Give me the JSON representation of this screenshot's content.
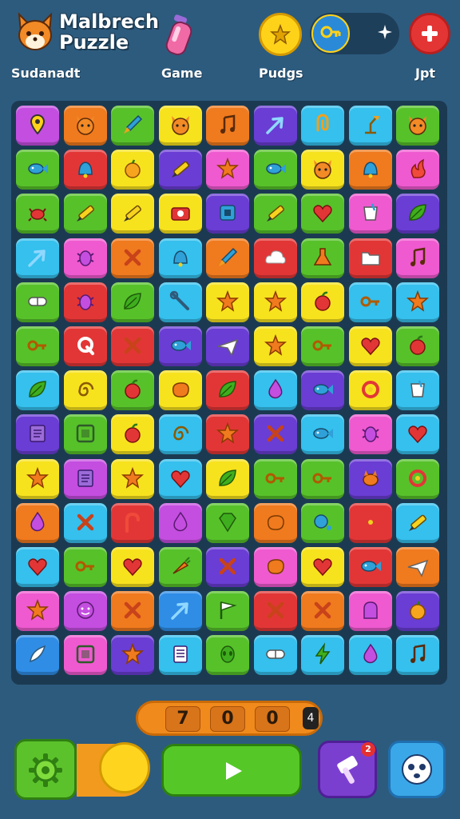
{
  "header": {
    "title_line1": "Malbrech",
    "title_line2": "Puzzle",
    "labels": [
      "Sudanadt",
      "Game",
      "Pudgs",
      "Jpt"
    ]
  },
  "board": {
    "rows": 13,
    "cols": 9,
    "palette": {
      "p": "#c44ee0",
      "o": "#f07a1e",
      "g": "#57c12a",
      "y": "#f7e21e",
      "c": "#35c0ee",
      "v": "#6a3dd4",
      "r": "#e23636",
      "m": "#ef5ad0",
      "b": "#2f8de6"
    },
    "tiles": [
      [
        "p",
        "o",
        "g",
        "y",
        "o",
        "v",
        "c",
        "c",
        "g"
      ],
      [
        "g",
        "r",
        "y",
        "v",
        "m",
        "g",
        "y",
        "o",
        "m"
      ],
      [
        "g",
        "g",
        "y",
        "y",
        "v",
        "g",
        "g",
        "m",
        "v"
      ],
      [
        "c",
        "m",
        "o",
        "c",
        "o",
        "r",
        "g",
        "r",
        "m"
      ],
      [
        "g",
        "r",
        "g",
        "c",
        "y",
        "y",
        "y",
        "c",
        "c"
      ],
      [
        "g",
        "r",
        "r",
        "v",
        "v",
        "y",
        "g",
        "y",
        "g"
      ],
      [
        "c",
        "y",
        "g",
        "y",
        "r",
        "c",
        "v",
        "y",
        "c"
      ],
      [
        "v",
        "g",
        "y",
        "c",
        "r",
        "v",
        "c",
        "m",
        "c"
      ],
      [
        "y",
        "p",
        "y",
        "c",
        "y",
        "g",
        "g",
        "v",
        "g"
      ],
      [
        "o",
        "c",
        "r",
        "p",
        "g",
        "o",
        "g",
        "r",
        "c"
      ],
      [
        "c",
        "g",
        "y",
        "g",
        "v",
        "m",
        "y",
        "r",
        "o"
      ],
      [
        "m",
        "p",
        "o",
        "b",
        "g",
        "r",
        "o",
        "m",
        "v"
      ],
      [
        "b",
        "m",
        "v",
        "c",
        "g",
        "c",
        "c",
        "c",
        "c"
      ]
    ],
    "icons": [
      [
        "pin",
        "fox",
        "rocket",
        "fox",
        "music",
        "arrow",
        "clip",
        "lamp",
        "fox"
      ],
      [
        "fish",
        "bell",
        "fruit",
        "pencil",
        "star",
        "fish",
        "fox",
        "bell",
        "flame"
      ],
      [
        "crab",
        "pencil",
        "pencil",
        "camera",
        "chip",
        "pencil",
        "heart",
        "cup",
        "leaf"
      ],
      [
        "arrow",
        "bug",
        "cross",
        "bell",
        "rocket",
        "cloud",
        "flask",
        "folder",
        "music"
      ],
      [
        "pill",
        "bug",
        "leaf",
        "tool",
        "star",
        "star",
        "apple",
        "key",
        "star"
      ],
      [
        "key",
        "q",
        "cross",
        "fish",
        "plane",
        "star",
        "key",
        "heart",
        "apple"
      ],
      [
        "leaf",
        "spiral",
        "apple",
        "blob",
        "leaf",
        "drop",
        "fish",
        "ring",
        "cup"
      ],
      [
        "book",
        "frame",
        "apple",
        "spiral",
        "star",
        "cross",
        "fish",
        "bug",
        "heart"
      ],
      [
        "star",
        "book",
        "star",
        "heart",
        "leaf",
        "key",
        "key",
        "dog",
        "ring"
      ],
      [
        "drop",
        "cross",
        "cane",
        "drop",
        "gem",
        "blob",
        "bubble",
        "ring",
        "pencil"
      ],
      [
        "heart",
        "key",
        "heart",
        "carrot",
        "cross",
        "blob",
        "heart",
        "fish",
        "plane"
      ],
      [
        "star",
        "smile",
        "cross",
        "arrow",
        "flag",
        "cross",
        "cross",
        "ghost",
        "fruit"
      ],
      [
        "feather",
        "frame",
        "star",
        "doc",
        "alien",
        "pill",
        "bolt",
        "drop",
        "music"
      ]
    ]
  },
  "score": {
    "digits": [
      "7",
      "0",
      "0"
    ],
    "end": "4"
  },
  "footer": {
    "badge": "2"
  },
  "colors": {
    "background": "#2d5b7e",
    "board": "#1b3a52",
    "play": "#55c827"
  }
}
